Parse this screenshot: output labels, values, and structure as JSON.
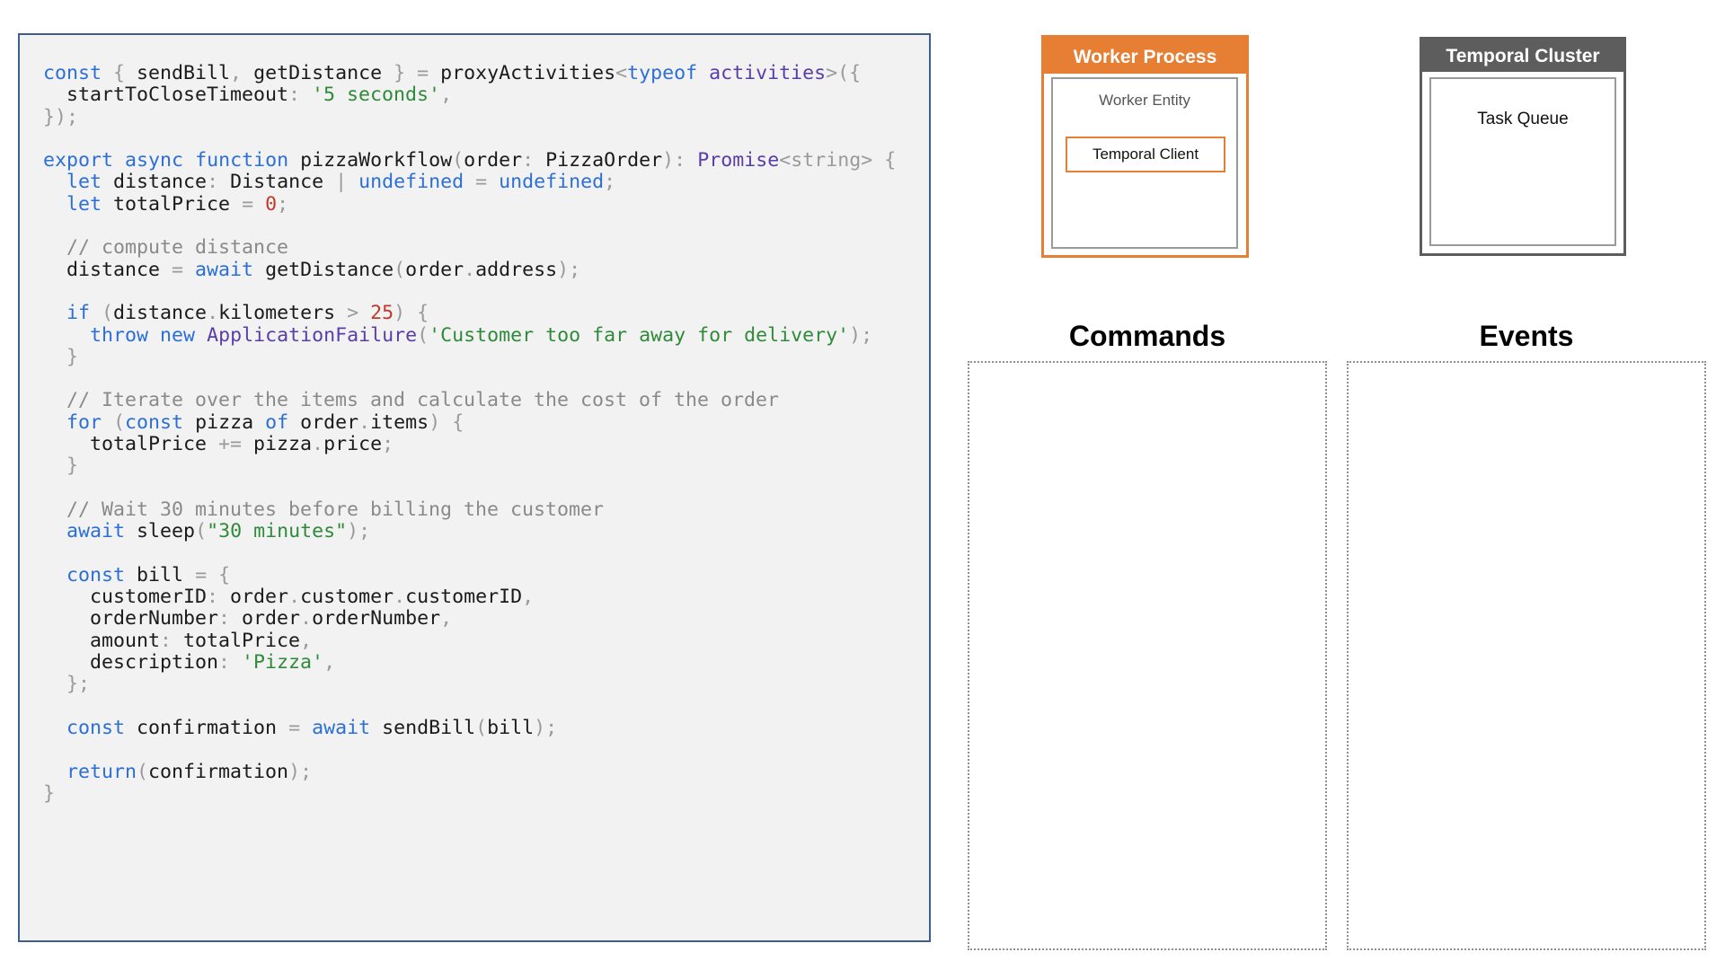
{
  "code": {
    "lines": [
      [
        [
          "const",
          "k"
        ],
        [
          " { ",
          "p"
        ],
        [
          "sendBill",
          "i"
        ],
        [
          ", ",
          "p"
        ],
        [
          "getDistance",
          "i"
        ],
        [
          " } = ",
          "p"
        ],
        [
          "proxyActivities",
          "i"
        ],
        [
          "<",
          "p"
        ],
        [
          "typeof",
          "k"
        ],
        [
          " ",
          "p"
        ],
        [
          "activities",
          "v"
        ],
        [
          ">({",
          "p"
        ]
      ],
      [
        [
          "  ",
          "p"
        ],
        [
          "startToCloseTimeout",
          "i"
        ],
        [
          ": ",
          "p"
        ],
        [
          "'5 seconds'",
          "s"
        ],
        [
          ",",
          "p"
        ]
      ],
      [
        [
          "});",
          "p"
        ]
      ],
      [],
      [
        [
          "export",
          "k"
        ],
        [
          " ",
          "p"
        ],
        [
          "async",
          "k"
        ],
        [
          " ",
          "p"
        ],
        [
          "function",
          "k"
        ],
        [
          " ",
          "p"
        ],
        [
          "pizzaWorkflow",
          "i"
        ],
        [
          "(",
          "p"
        ],
        [
          "order",
          "i"
        ],
        [
          ": ",
          "p"
        ],
        [
          "PizzaOrder",
          "i"
        ],
        [
          "): ",
          "p"
        ],
        [
          "Promise",
          "v"
        ],
        [
          "<string> {",
          "p"
        ]
      ],
      [
        [
          "  ",
          "p"
        ],
        [
          "let",
          "k"
        ],
        [
          " ",
          "p"
        ],
        [
          "distance",
          "i"
        ],
        [
          ": ",
          "p"
        ],
        [
          "Distance",
          "i"
        ],
        [
          " | ",
          "p"
        ],
        [
          "undefined",
          "k"
        ],
        [
          " = ",
          "p"
        ],
        [
          "undefined",
          "k"
        ],
        [
          ";",
          "p"
        ]
      ],
      [
        [
          "  ",
          "p"
        ],
        [
          "let",
          "k"
        ],
        [
          " ",
          "p"
        ],
        [
          "totalPrice",
          "i"
        ],
        [
          " = ",
          "p"
        ],
        [
          "0",
          "n"
        ],
        [
          ";",
          "p"
        ]
      ],
      [],
      [
        [
          "  // compute distance",
          "c"
        ]
      ],
      [
        [
          "  ",
          "p"
        ],
        [
          "distance",
          "i"
        ],
        [
          " = ",
          "p"
        ],
        [
          "await",
          "k"
        ],
        [
          " ",
          "p"
        ],
        [
          "getDistance",
          "i"
        ],
        [
          "(",
          "p"
        ],
        [
          "order",
          "i"
        ],
        [
          ".",
          "p"
        ],
        [
          "address",
          "i"
        ],
        [
          ");",
          "p"
        ]
      ],
      [],
      [
        [
          "  ",
          "p"
        ],
        [
          "if",
          "k"
        ],
        [
          " (",
          "p"
        ],
        [
          "distance",
          "i"
        ],
        [
          ".",
          "p"
        ],
        [
          "kilometers",
          "i"
        ],
        [
          " > ",
          "p"
        ],
        [
          "25",
          "n"
        ],
        [
          ") {",
          "p"
        ]
      ],
      [
        [
          "    ",
          "p"
        ],
        [
          "throw",
          "k"
        ],
        [
          " ",
          "p"
        ],
        [
          "new",
          "k"
        ],
        [
          " ",
          "p"
        ],
        [
          "ApplicationFailure",
          "v"
        ],
        [
          "(",
          "p"
        ],
        [
          "'Customer too far away for delivery'",
          "s"
        ],
        [
          ");",
          "p"
        ]
      ],
      [
        [
          "  }",
          "p"
        ]
      ],
      [],
      [
        [
          "  // Iterate over the items and calculate the cost of the order",
          "c"
        ]
      ],
      [
        [
          "  ",
          "p"
        ],
        [
          "for",
          "k"
        ],
        [
          " (",
          "p"
        ],
        [
          "const",
          "k"
        ],
        [
          " ",
          "p"
        ],
        [
          "pizza",
          "i"
        ],
        [
          " ",
          "p"
        ],
        [
          "of",
          "k"
        ],
        [
          " ",
          "p"
        ],
        [
          "order",
          "i"
        ],
        [
          ".",
          "p"
        ],
        [
          "items",
          "i"
        ],
        [
          ") {",
          "p"
        ]
      ],
      [
        [
          "    ",
          "p"
        ],
        [
          "totalPrice",
          "i"
        ],
        [
          " += ",
          "p"
        ],
        [
          "pizza",
          "i"
        ],
        [
          ".",
          "p"
        ],
        [
          "price",
          "i"
        ],
        [
          ";",
          "p"
        ]
      ],
      [
        [
          "  }",
          "p"
        ]
      ],
      [],
      [
        [
          "  // Wait 30 minutes before billing the customer",
          "c"
        ]
      ],
      [
        [
          "  ",
          "p"
        ],
        [
          "await",
          "k"
        ],
        [
          " ",
          "p"
        ],
        [
          "sleep",
          "i"
        ],
        [
          "(",
          "p"
        ],
        [
          "\"30 minutes\"",
          "s"
        ],
        [
          ");",
          "p"
        ]
      ],
      [],
      [
        [
          "  ",
          "p"
        ],
        [
          "const",
          "k"
        ],
        [
          " ",
          "p"
        ],
        [
          "bill",
          "i"
        ],
        [
          " = {",
          "p"
        ]
      ],
      [
        [
          "    ",
          "p"
        ],
        [
          "customerID",
          "i"
        ],
        [
          ": ",
          "p"
        ],
        [
          "order",
          "i"
        ],
        [
          ".",
          "p"
        ],
        [
          "customer",
          "i"
        ],
        [
          ".",
          "p"
        ],
        [
          "customerID",
          "i"
        ],
        [
          ",",
          "p"
        ]
      ],
      [
        [
          "    ",
          "p"
        ],
        [
          "orderNumber",
          "i"
        ],
        [
          ": ",
          "p"
        ],
        [
          "order",
          "i"
        ],
        [
          ".",
          "p"
        ],
        [
          "orderNumber",
          "i"
        ],
        [
          ",",
          "p"
        ]
      ],
      [
        [
          "    ",
          "p"
        ],
        [
          "amount",
          "i"
        ],
        [
          ": ",
          "p"
        ],
        [
          "totalPrice",
          "i"
        ],
        [
          ",",
          "p"
        ]
      ],
      [
        [
          "    ",
          "p"
        ],
        [
          "description",
          "i"
        ],
        [
          ": ",
          "p"
        ],
        [
          "'Pizza'",
          "s"
        ],
        [
          ",",
          "p"
        ]
      ],
      [
        [
          "  };",
          "p"
        ]
      ],
      [],
      [
        [
          "  ",
          "p"
        ],
        [
          "const",
          "k"
        ],
        [
          " ",
          "p"
        ],
        [
          "confirmation",
          "i"
        ],
        [
          " = ",
          "p"
        ],
        [
          "await",
          "k"
        ],
        [
          " ",
          "p"
        ],
        [
          "sendBill",
          "i"
        ],
        [
          "(",
          "p"
        ],
        [
          "bill",
          "i"
        ],
        [
          ");",
          "p"
        ]
      ],
      [],
      [
        [
          "  ",
          "p"
        ],
        [
          "return",
          "k"
        ],
        [
          "(",
          "p"
        ],
        [
          "confirmation",
          "i"
        ],
        [
          ");",
          "p"
        ]
      ],
      [
        [
          "}",
          "p"
        ]
      ]
    ]
  },
  "worker_process": {
    "title": "Worker Process",
    "entity_label": "Worker Entity",
    "client_label": "Temporal Client"
  },
  "temporal_cluster": {
    "title": "Temporal Cluster",
    "queue_label": "Task Queue"
  },
  "commands": {
    "title": "Commands",
    "items": []
  },
  "events": {
    "title": "Events",
    "items": []
  },
  "colors": {
    "worker_orange": "#e67e33",
    "cluster_grey": "#5d5d5d",
    "code_border": "#3d5f8f",
    "code_bg": "#f2f2f2"
  }
}
